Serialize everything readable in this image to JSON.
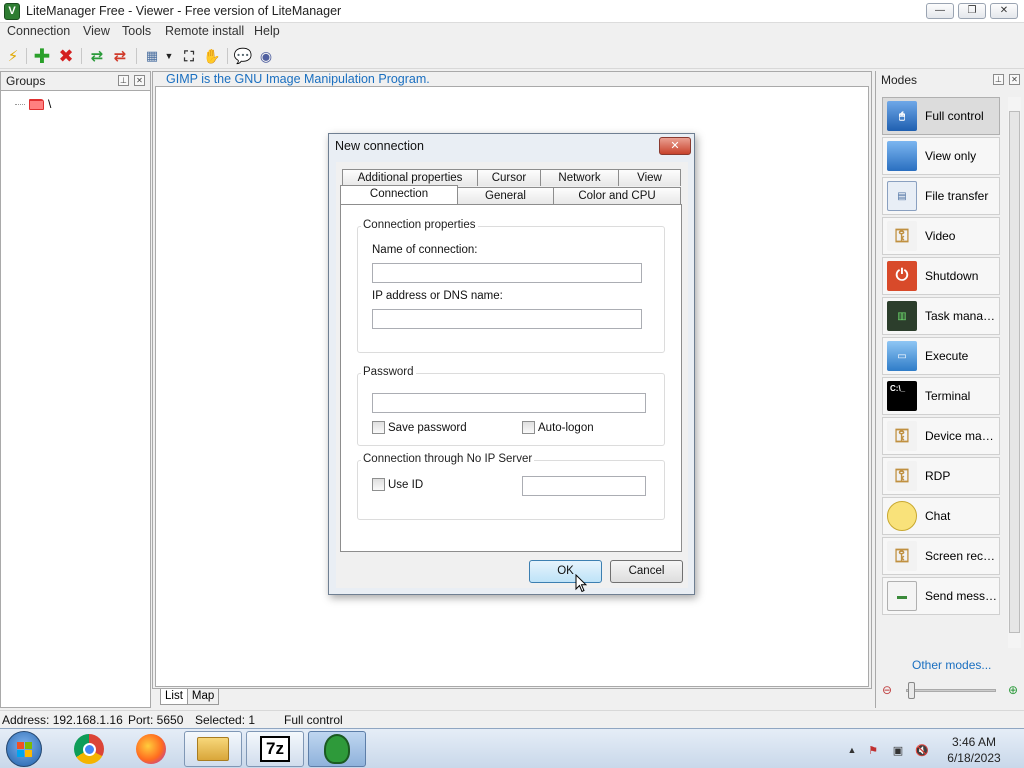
{
  "window": {
    "title": "LiteManager Free - Viewer - Free version of LiteManager",
    "app_icon_letter": "V",
    "minimize_glyph": "—",
    "maximize_glyph": "❐",
    "close_glyph": "✕"
  },
  "menu": [
    "Connection",
    "View",
    "Tools",
    "Remote install",
    "Help"
  ],
  "groups_panel": {
    "title": "Groups",
    "pin_glyph": "⊥",
    "close_glyph": "✕",
    "tree_root": "\\"
  },
  "main": {
    "caption": "GIMP is the GNU Image Manipulation Program.",
    "bottom_tabs": [
      "List",
      "Map"
    ]
  },
  "modes_panel": {
    "title": "Modes",
    "items": [
      {
        "label": "Full control",
        "icon": "full-control-icon",
        "active": true
      },
      {
        "label": "View only",
        "icon": "view-only-icon"
      },
      {
        "label": "File transfer",
        "icon": "file-transfer-icon"
      },
      {
        "label": "Video",
        "icon": "video-icon"
      },
      {
        "label": "Shutdown",
        "icon": "shutdown-icon"
      },
      {
        "label": "Task manager",
        "icon": "task-manager-icon"
      },
      {
        "label": "Execute",
        "icon": "execute-icon"
      },
      {
        "label": "Terminal",
        "icon": "terminal-icon"
      },
      {
        "label": "Device mana...",
        "icon": "device-manager-icon"
      },
      {
        "label": "RDP",
        "icon": "rdp-icon"
      },
      {
        "label": "Chat",
        "icon": "chat-icon"
      },
      {
        "label": "Screen recor...",
        "icon": "screen-recorder-icon"
      },
      {
        "label": "Send message",
        "icon": "send-message-icon"
      }
    ],
    "other_modes": "Other modes..."
  },
  "status": {
    "address": "Address: 192.168.1.16",
    "port": "Port: 5650",
    "selected": "Selected: 1",
    "mode": "Full control"
  },
  "taskbar": {
    "apps": [
      "chrome",
      "firefox",
      "file-explorer",
      "7zip",
      "litemanager"
    ],
    "sevenzip_label": "7z",
    "time": "3:46 AM",
    "date": "6/18/2023"
  },
  "dialog": {
    "title": "New connection",
    "tabs_row1": [
      "Additional properties",
      "Cursor",
      "Network",
      "View"
    ],
    "tabs_row2": [
      "Connection",
      "General",
      "Color and CPU"
    ],
    "active_tab": "Connection",
    "group_connection": "Connection properties",
    "name_label": "Name of connection:",
    "name_value": "",
    "ip_label": "IP address or DNS name:",
    "ip_value": "",
    "group_password": "Password",
    "password_value": "",
    "save_password": "Save password",
    "auto_logon": "Auto-logon",
    "group_noip": "Connection through No IP Server",
    "use_id": "Use ID",
    "id_value": "",
    "ok": "OK",
    "cancel": "Cancel"
  },
  "colors": {
    "accent_link": "#1a6fc0",
    "close_red": "#c8432c"
  }
}
